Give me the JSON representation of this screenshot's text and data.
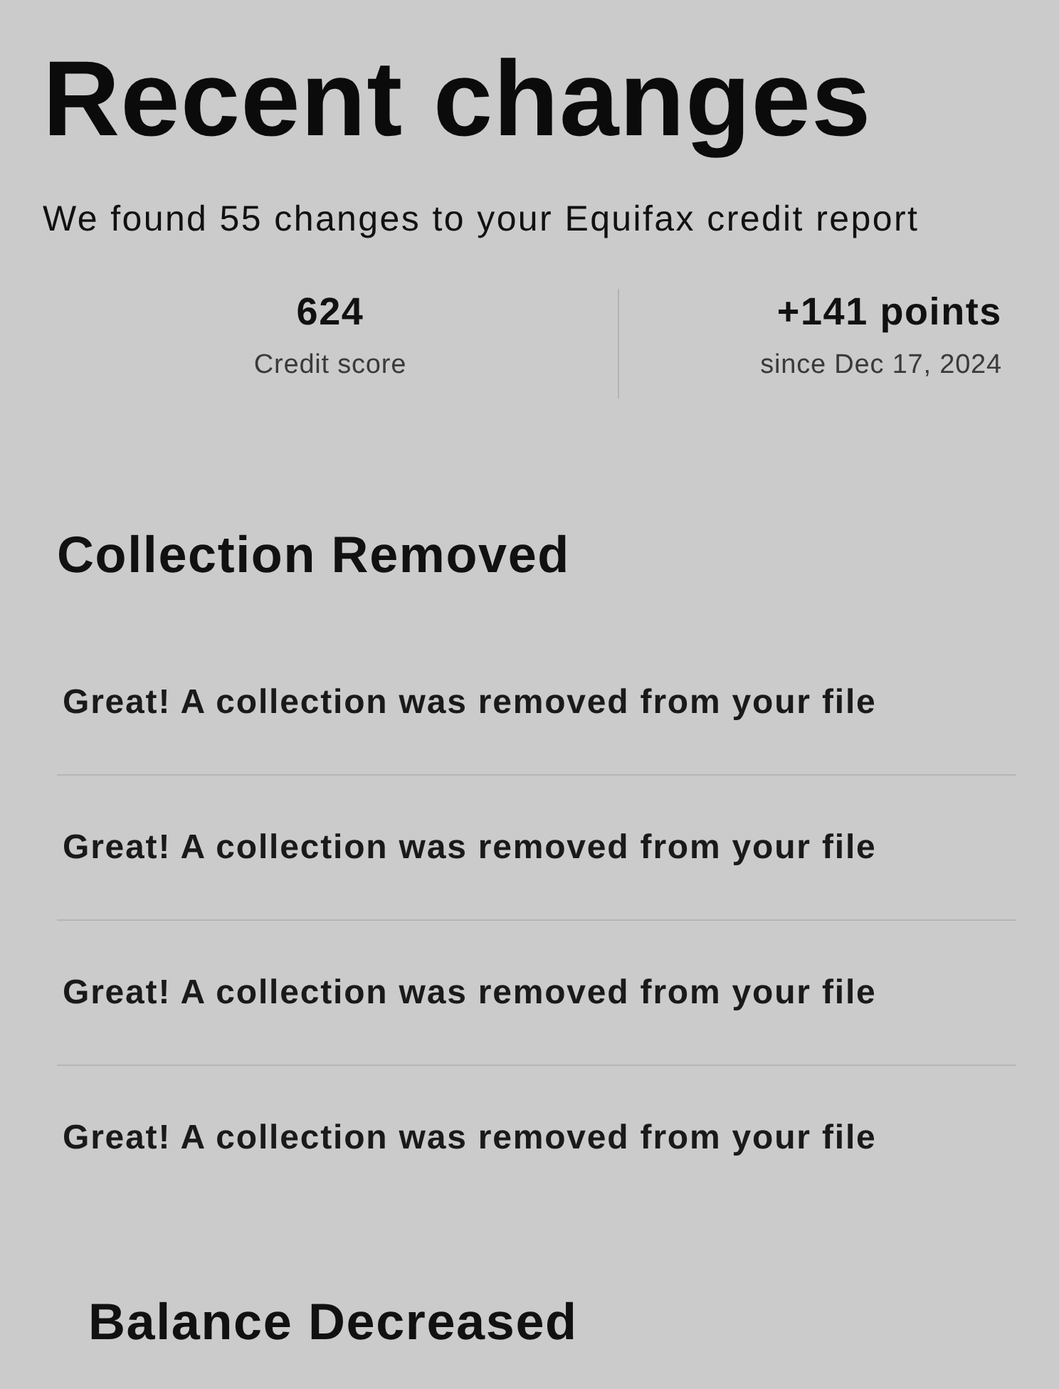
{
  "title": "Recent changes",
  "subtitle": "We found 55 changes to your Equifax credit report",
  "stats": [
    {
      "value": "624",
      "label": "Credit score"
    },
    {
      "value": "+141 points",
      "label": "since Dec 17, 2024"
    }
  ],
  "sections": [
    {
      "heading": "Collection Removed",
      "items": [
        "Great! A collection was removed from your file",
        "Great! A collection was removed from your file",
        "Great! A collection was removed from your file",
        "Great! A collection was removed from your file"
      ]
    },
    {
      "heading": "Balance Decreased"
    }
  ]
}
